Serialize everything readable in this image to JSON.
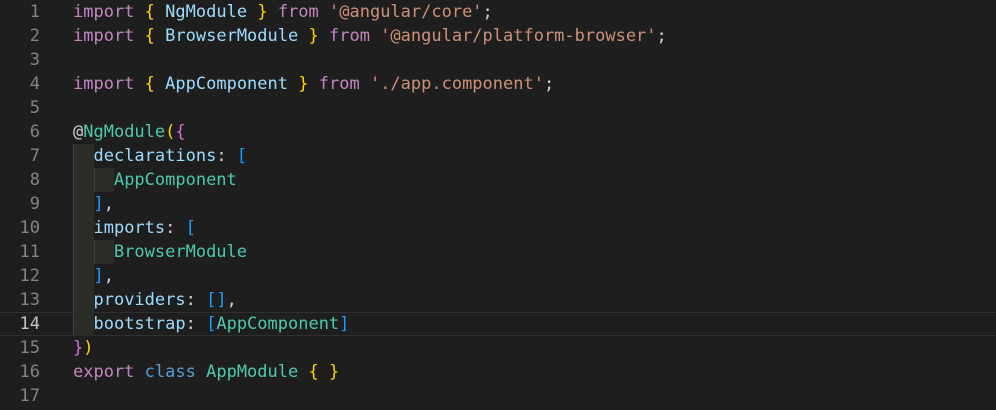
{
  "editor": {
    "current_line": 14,
    "lines": [
      {
        "n": "1",
        "tokens": [
          [
            "kw",
            "import"
          ],
          [
            "punc",
            " "
          ],
          [
            "br1",
            "{"
          ],
          [
            "punc",
            " "
          ],
          [
            "ident",
            "NgModule"
          ],
          [
            "punc",
            " "
          ],
          [
            "br1",
            "}"
          ],
          [
            "punc",
            " "
          ],
          [
            "kw",
            "from"
          ],
          [
            "punc",
            " "
          ],
          [
            "str",
            "'@angular/core'"
          ],
          [
            "punc",
            ";"
          ]
        ]
      },
      {
        "n": "2",
        "tokens": [
          [
            "kw",
            "import"
          ],
          [
            "punc",
            " "
          ],
          [
            "br1",
            "{"
          ],
          [
            "punc",
            " "
          ],
          [
            "ident",
            "BrowserModule"
          ],
          [
            "punc",
            " "
          ],
          [
            "br1",
            "}"
          ],
          [
            "punc",
            " "
          ],
          [
            "kw",
            "from"
          ],
          [
            "punc",
            " "
          ],
          [
            "str",
            "'@angular/platform-browser'"
          ],
          [
            "punc",
            ";"
          ]
        ]
      },
      {
        "n": "3",
        "tokens": []
      },
      {
        "n": "4",
        "tokens": [
          [
            "kw",
            "import"
          ],
          [
            "punc",
            " "
          ],
          [
            "br1",
            "{"
          ],
          [
            "punc",
            " "
          ],
          [
            "ident",
            "AppComponent"
          ],
          [
            "punc",
            " "
          ],
          [
            "br1",
            "}"
          ],
          [
            "punc",
            " "
          ],
          [
            "kw",
            "from"
          ],
          [
            "punc",
            " "
          ],
          [
            "str",
            "'./app.component'"
          ],
          [
            "punc",
            ";"
          ]
        ]
      },
      {
        "n": "5",
        "tokens": []
      },
      {
        "n": "6",
        "tokens": [
          [
            "dec",
            "@"
          ],
          [
            "cls",
            "NgModule"
          ],
          [
            "br1",
            "("
          ],
          [
            "br2",
            "{"
          ]
        ]
      },
      {
        "n": "7",
        "tokens": [
          [
            "punc",
            "  "
          ],
          [
            "ident",
            "declarations"
          ],
          [
            "punc",
            ": "
          ],
          [
            "br3",
            "["
          ]
        ]
      },
      {
        "n": "8",
        "tokens": [
          [
            "punc",
            "    "
          ],
          [
            "cls",
            "AppComponent"
          ]
        ]
      },
      {
        "n": "9",
        "tokens": [
          [
            "punc",
            "  "
          ],
          [
            "br3",
            "]"
          ],
          [
            "punc",
            ","
          ]
        ]
      },
      {
        "n": "10",
        "tokens": [
          [
            "punc",
            "  "
          ],
          [
            "ident",
            "imports"
          ],
          [
            "punc",
            ": "
          ],
          [
            "br3",
            "["
          ]
        ]
      },
      {
        "n": "11",
        "tokens": [
          [
            "punc",
            "    "
          ],
          [
            "cls",
            "BrowserModule"
          ]
        ]
      },
      {
        "n": "12",
        "tokens": [
          [
            "punc",
            "  "
          ],
          [
            "br3",
            "]"
          ],
          [
            "punc",
            ","
          ]
        ]
      },
      {
        "n": "13",
        "tokens": [
          [
            "punc",
            "  "
          ],
          [
            "ident",
            "providers"
          ],
          [
            "punc",
            ": "
          ],
          [
            "br3",
            "[]"
          ],
          [
            "punc",
            ","
          ]
        ]
      },
      {
        "n": "14",
        "tokens": [
          [
            "punc",
            "  "
          ],
          [
            "ident",
            "bootstrap"
          ],
          [
            "punc",
            ": "
          ],
          [
            "br3",
            "["
          ],
          [
            "cls",
            "AppComponent"
          ],
          [
            "br3",
            "]"
          ]
        ]
      },
      {
        "n": "15",
        "tokens": [
          [
            "br2",
            "}"
          ],
          [
            "br1",
            ")"
          ]
        ]
      },
      {
        "n": "16",
        "tokens": [
          [
            "kw",
            "export"
          ],
          [
            "punc",
            " "
          ],
          [
            "kw2",
            "class"
          ],
          [
            "punc",
            " "
          ],
          [
            "cls",
            "AppModule"
          ],
          [
            "punc",
            " "
          ],
          [
            "br1",
            "{"
          ],
          [
            "punc",
            " "
          ],
          [
            "br1",
            "}"
          ]
        ]
      },
      {
        "n": "17",
        "tokens": []
      }
    ],
    "colors": {
      "background": "#1e1e1e",
      "keyword": "#c586c0",
      "storage": "#569cd6",
      "variable": "#9cdcfe",
      "type": "#4ec9b0",
      "string": "#ce9178",
      "bracket_1": "#ffd700",
      "bracket_2": "#da70d6",
      "bracket_3": "#179fff",
      "line_number": "#858585"
    }
  }
}
